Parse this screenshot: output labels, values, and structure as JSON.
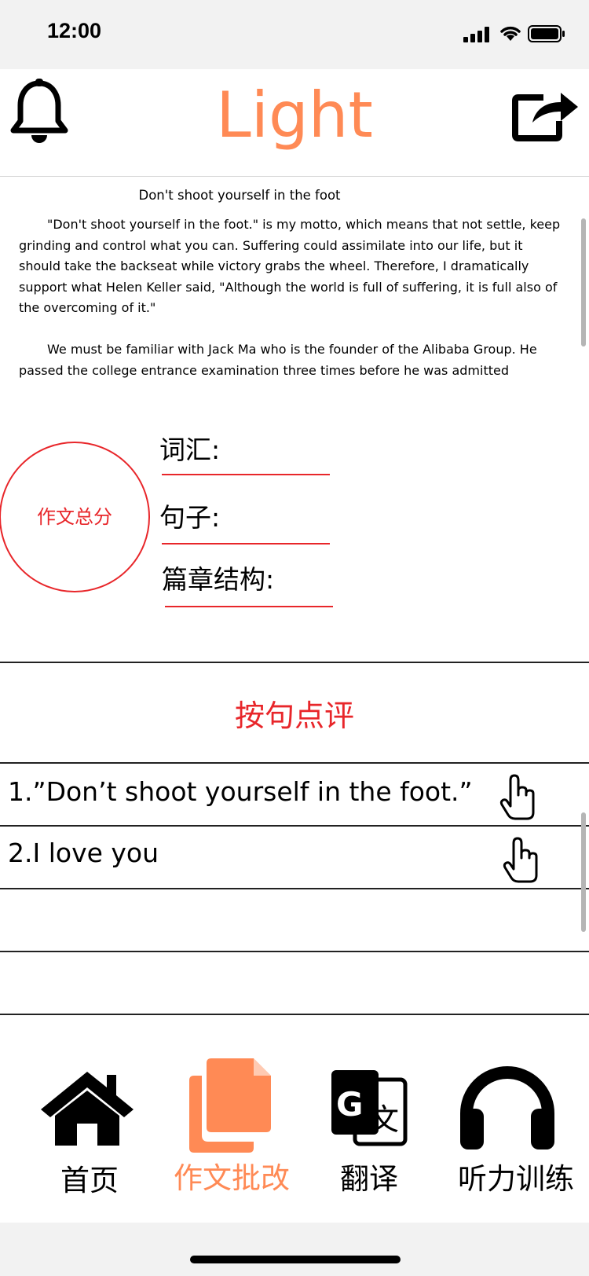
{
  "status_bar": {
    "time": "12:00"
  },
  "header": {
    "title": "Light"
  },
  "essay": {
    "title": "Don't shoot yourself in the foot",
    "paragraphs": [
      "\"Don't shoot yourself in the foot.\" is my motto, which means that not settle, keep grinding and control what you can. Suffering could assimilate into our life, but it should take the backseat while victory grabs the wheel. Therefore, I dramatically support what Helen Keller said, \"Although the world is full of suffering, it is full also of the overcoming of it.\"",
      "We must be familiar with Jack Ma who is the founder of the Alibaba Group. He passed the college entrance examination three times before he was admitted"
    ]
  },
  "score": {
    "total_label": "作文总分",
    "vocab_label": "词汇:",
    "sentence_label": "句子:",
    "structure_label": "篇章结构:"
  },
  "comments": {
    "title": "按句点评",
    "items": [
      {
        "text": "1.”Don’t shoot yourself in the foot.”"
      },
      {
        "text": "2.I love you"
      }
    ]
  },
  "tabs": [
    {
      "label": "首页",
      "icon": "home-icon",
      "active": false
    },
    {
      "label": "作文批改",
      "icon": "document-icon",
      "active": true
    },
    {
      "label": "翻译",
      "icon": "translate-icon",
      "active": false
    },
    {
      "label": "听力训练",
      "icon": "headphones-icon",
      "active": false
    }
  ],
  "colors": {
    "accent": "#ff8a55",
    "red": "#e8262a"
  }
}
